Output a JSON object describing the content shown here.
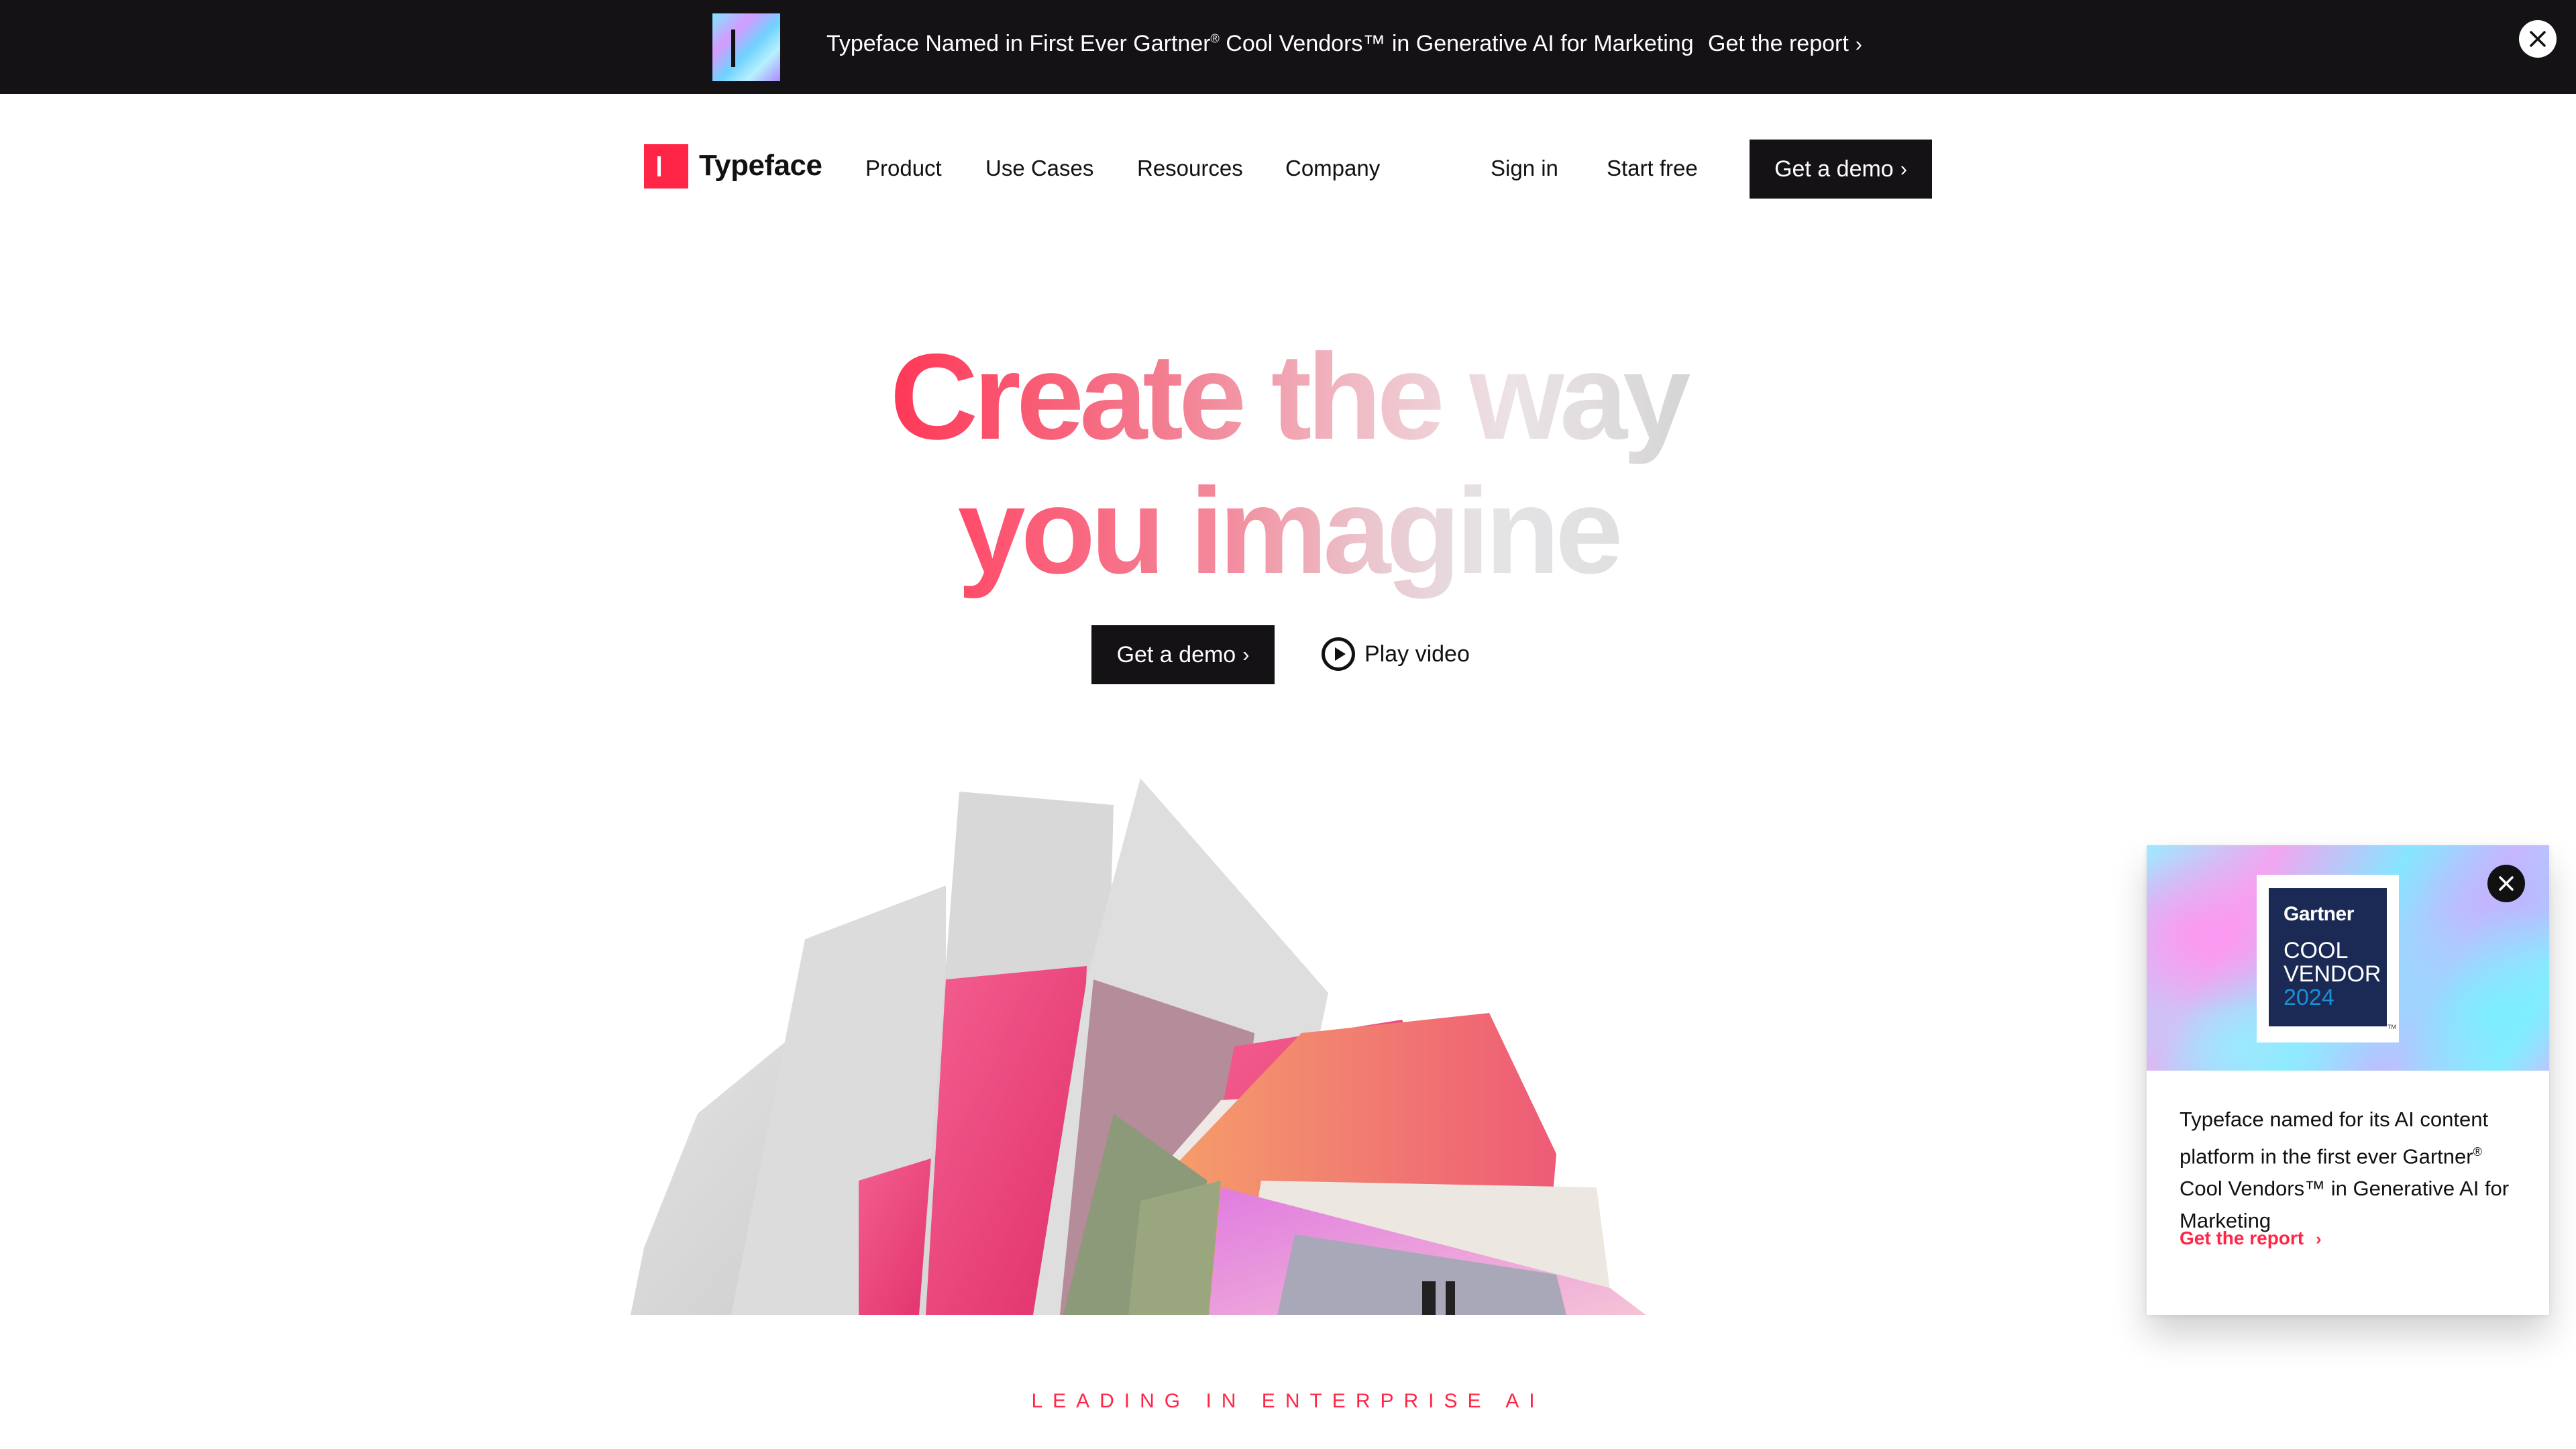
{
  "announcement": {
    "message_prefix": "Typeface Named in First Ever Gartner",
    "message_reg": "®",
    "message_suffix": " Cool Vendors™ in Generative AI for Marketing",
    "cta_label": "Get the report",
    "chevron": "›"
  },
  "nav": {
    "brand": "Typeface",
    "links": [
      "Product",
      "Use Cases",
      "Resources",
      "Company"
    ],
    "sign_in": "Sign in",
    "start_free": "Start free",
    "demo_label": "Get a demo",
    "chevron": "›"
  },
  "hero": {
    "headline_line1": "Create the way",
    "headline_line2": "you imagine",
    "demo_label": "Get a demo",
    "chevron": "›",
    "play_label": "Play video",
    "tagline": "LEADING IN ENTERPRISE AI"
  },
  "popup": {
    "badge_brand": "Gartner",
    "badge_line1": "COOL",
    "badge_line2": "VENDOR",
    "badge_year": "2024",
    "badge_tm": "TM",
    "body_prefix": "Typeface named for its AI content platform in the first ever Gartner",
    "body_reg": "®",
    "body_suffix": " Cool Vendors™ in Generative AI for Marketing",
    "link_label": "Get the report",
    "chevron": "›"
  },
  "colors": {
    "brand_red": "#ff2546",
    "dark": "#141215",
    "badge_navy": "#1b2a55",
    "badge_blue": "#1b8fd6"
  }
}
